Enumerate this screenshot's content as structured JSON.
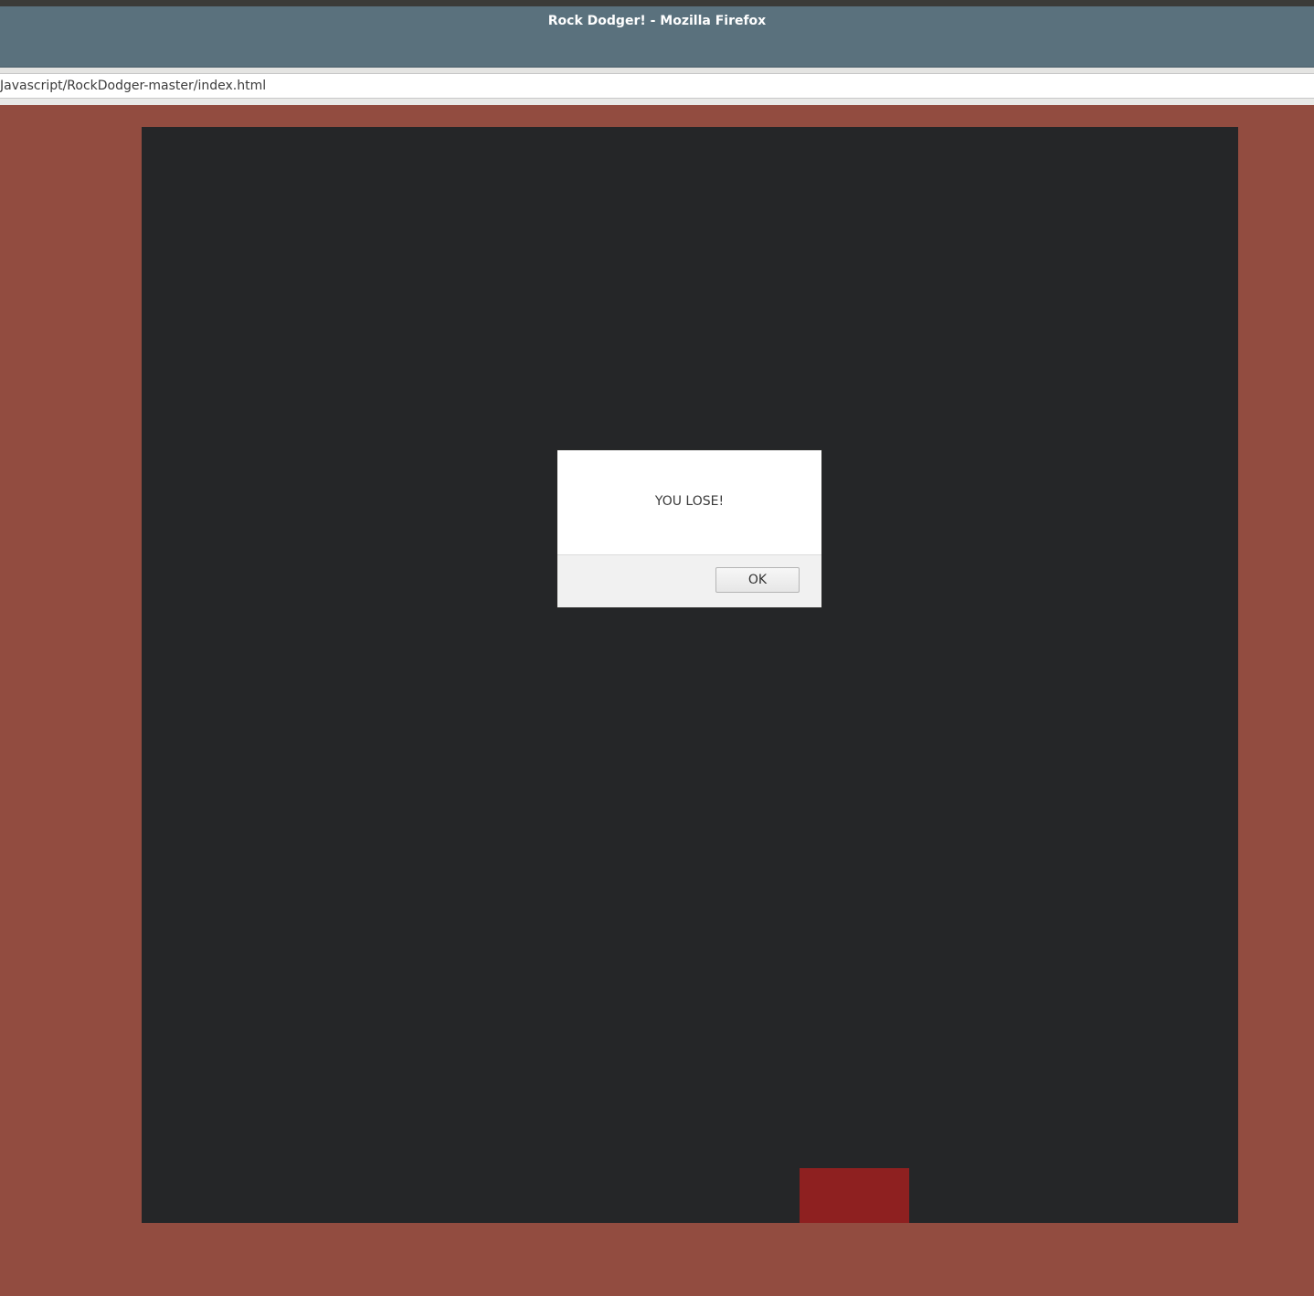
{
  "window": {
    "title": "Rock Dodger! - Mozilla Firefox"
  },
  "address_bar": {
    "url": "Javascript/RockDodger-master/index.html"
  },
  "page": {
    "background_color": "#924c40",
    "game": {
      "canvas_color": "#252628",
      "player_color": "#8e2020"
    }
  },
  "alert": {
    "message": "YOU LOSE!",
    "ok_label": "OK"
  }
}
